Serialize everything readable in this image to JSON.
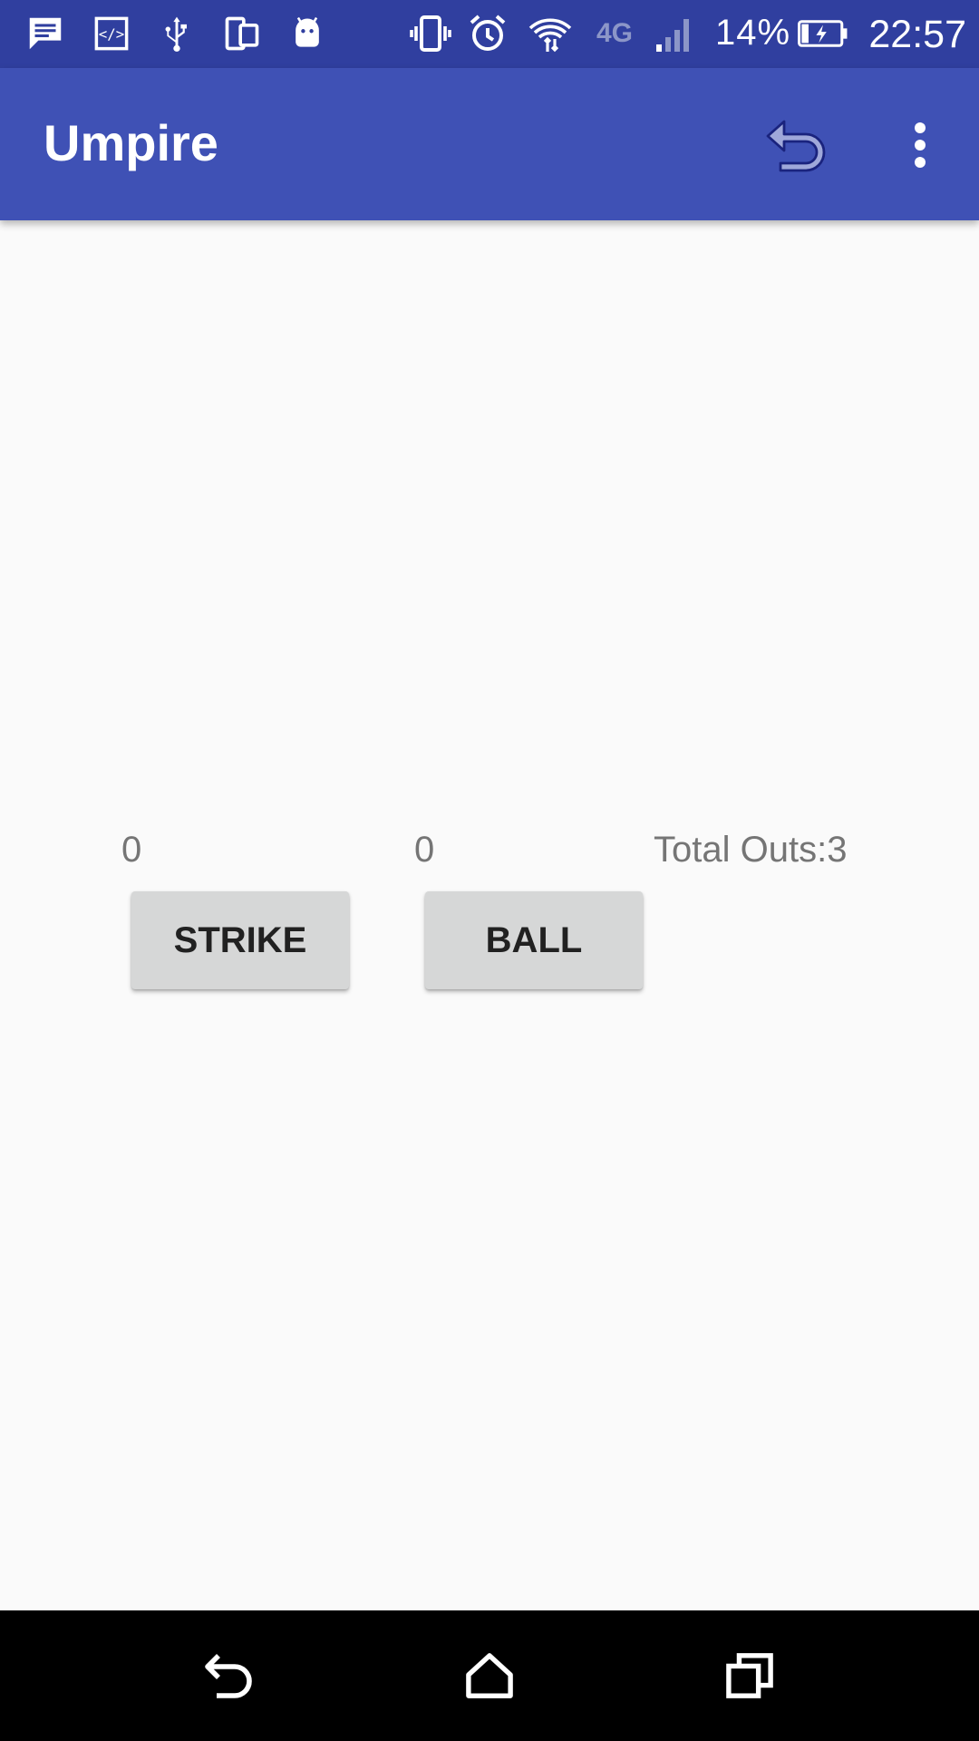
{
  "status_bar": {
    "icons": [
      "message-icon",
      "code-icon",
      "usb-icon",
      "devices-icon",
      "android-icon",
      "vibrate-icon",
      "alarm-icon",
      "wifi-icon",
      "4g-lte-icon",
      "signal-icon",
      "battery-charging-icon"
    ],
    "network_label": "4G",
    "battery_percent": "14%",
    "time": "22:57"
  },
  "app_bar": {
    "title": "Umpire",
    "actions": [
      "undo-icon",
      "overflow-menu-icon"
    ]
  },
  "counters": {
    "strike_count": "0",
    "ball_count": "0",
    "total_outs": "Total Outs:3"
  },
  "buttons": {
    "strike_label": "STRIKE",
    "ball_label": "BALL"
  },
  "nav_bar": {
    "buttons": [
      "back-icon",
      "home-icon",
      "recents-icon"
    ]
  },
  "colors": {
    "status_bar": "#303f9f",
    "app_bar": "#3f51b5",
    "background": "#fafafa",
    "button": "#d6d7d7",
    "counter_text": "#757575",
    "nav_bar": "#000000"
  }
}
